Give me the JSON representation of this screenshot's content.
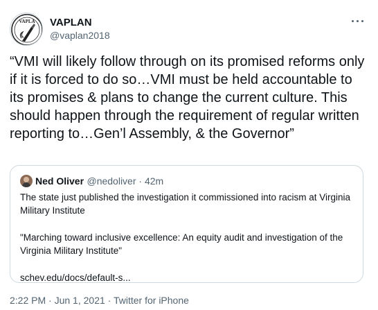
{
  "author": {
    "display_name": "VAPLAN",
    "handle": "@vaplan2018",
    "avatar_icon": "vaplan-pen-logo-icon",
    "avatar_logo_text": "VAPLA"
  },
  "more_menu": {
    "icon": "more-horizontal-icon"
  },
  "tweet": {
    "text": "“VMI will likely follow through on its promised reforms only if it is forced to do so…VMI must be held accountable to its promises & plans to change the current culture. This should happen through the requirement of regular written reporting to…Gen’l Assembly, & the Governor”"
  },
  "quoted_tweet": {
    "display_name": "Ned Oliver",
    "handle": "@nedoliver",
    "time": "42m",
    "paragraph_1": "The state just published the investigation it commissioned into racism at Virginia Military Institute",
    "paragraph_2": "\"Marching toward inclusive excellence: An equity audit and investigation of the Virginia Military Institute\"",
    "link_text": "schev.edu/docs/default-s..."
  },
  "footer": {
    "time": "2:22 PM",
    "date": "Jun 1, 2021",
    "source": "Twitter for iPhone"
  },
  "colors": {
    "text_primary": "#0f1419",
    "text_secondary": "#536471",
    "border": "#cfd9de"
  }
}
